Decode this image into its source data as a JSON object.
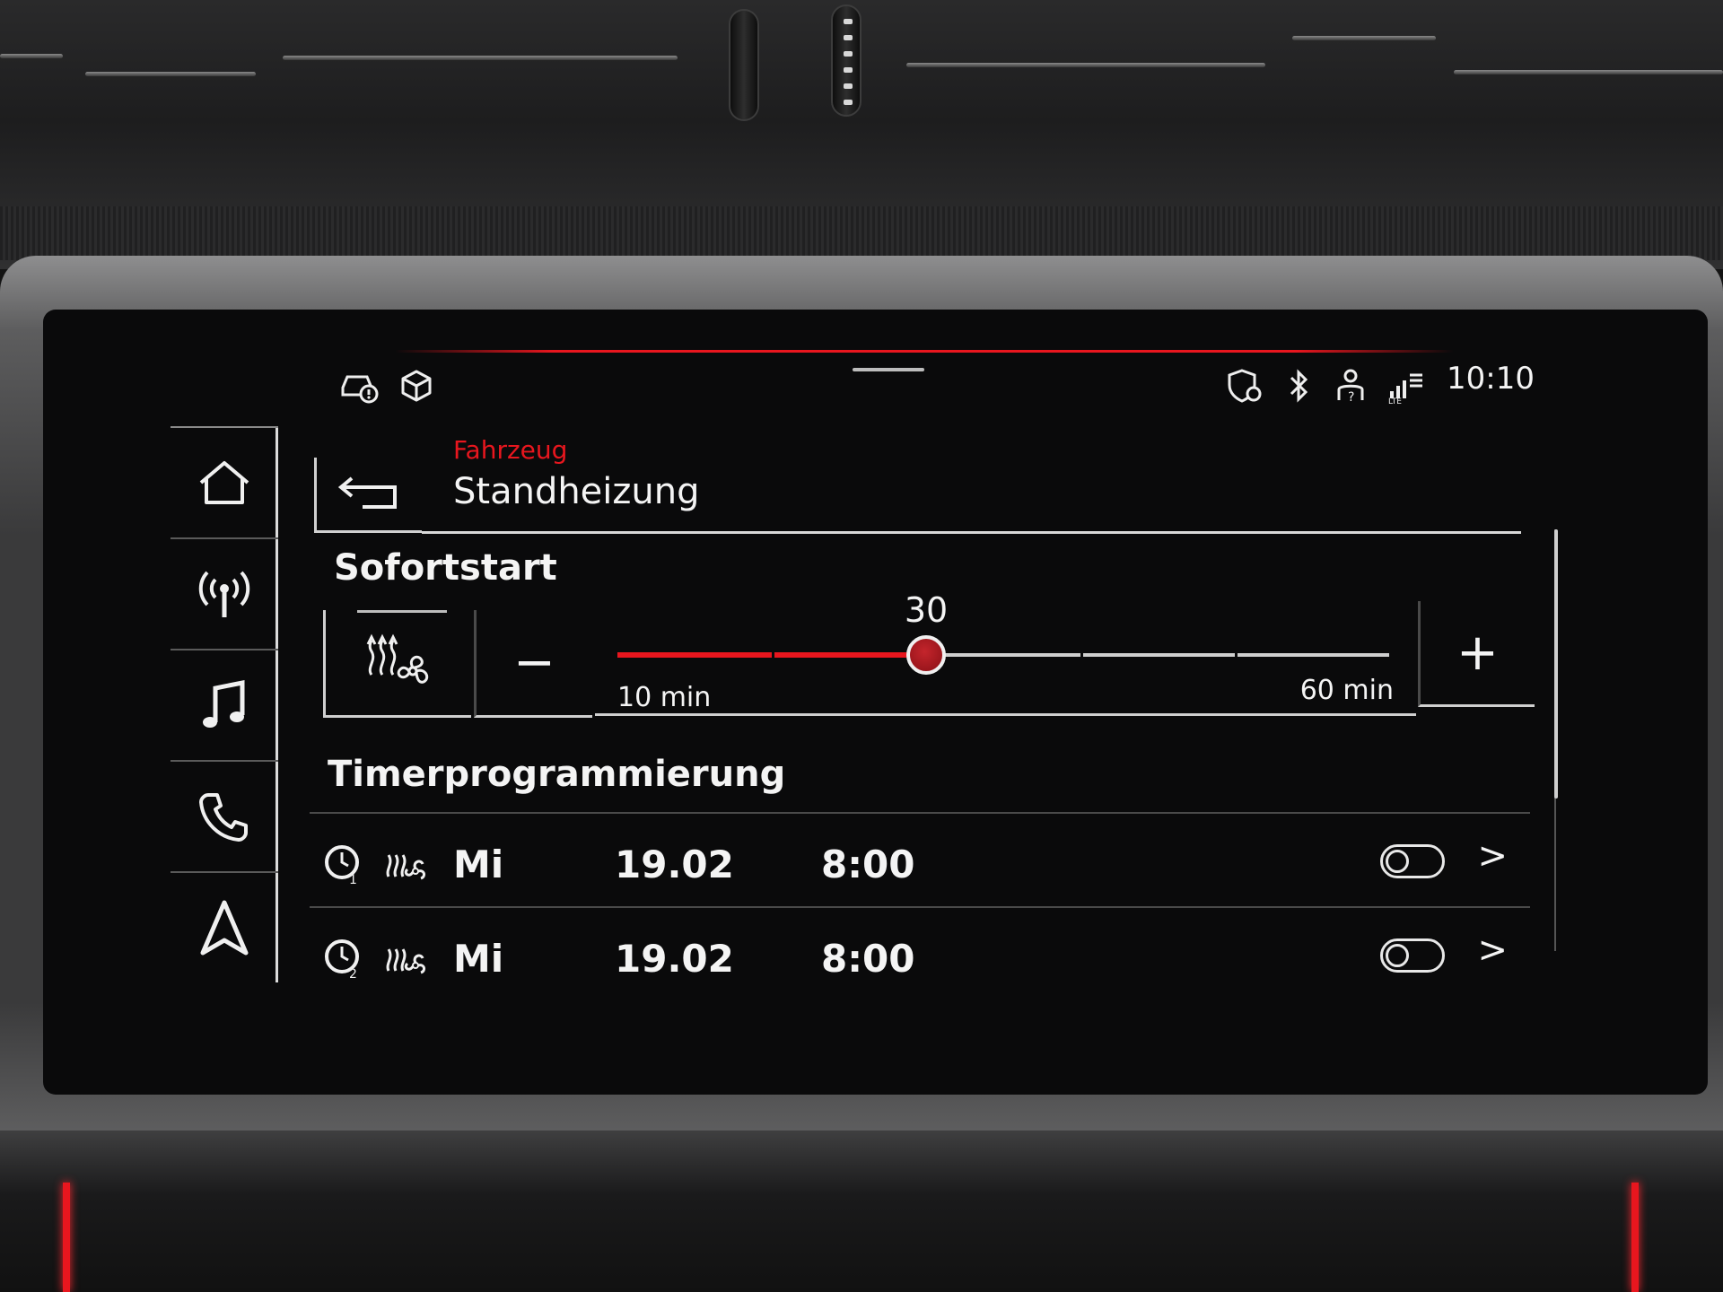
{
  "status_bar": {
    "time": "10:10",
    "icons_left": [
      "car-warning-icon",
      "cube-icon"
    ],
    "icons_right": [
      "shield-location-icon",
      "bluetooth-icon",
      "user-question-icon",
      "lte-signal-icon"
    ]
  },
  "nav": {
    "items": [
      {
        "icon": "home-icon"
      },
      {
        "icon": "radio-icon"
      },
      {
        "icon": "music-icon"
      },
      {
        "icon": "phone-icon"
      },
      {
        "icon": "navigation-icon"
      }
    ]
  },
  "header": {
    "breadcrumb": "Fahrzeug",
    "title": "Standheizung"
  },
  "sofortstart": {
    "label": "Sofortstart",
    "slider": {
      "value": 30,
      "value_label": "30",
      "min": 10,
      "max": 60,
      "min_label": "10 min",
      "max_label": "60 min"
    },
    "minus_label": "−",
    "plus_label": "+"
  },
  "timer": {
    "label": "Timerprogrammierung",
    "rows": [
      {
        "slot": "1",
        "day": "Mi",
        "date": "19.02",
        "time": "8:00",
        "enabled": false
      },
      {
        "slot": "2",
        "day": "Mi",
        "date": "19.02",
        "time": "8:00",
        "enabled": false
      }
    ]
  },
  "colors": {
    "accent_red": "#e8161e",
    "text": "#f4f4f4",
    "screen_bg": "#0a0a0b"
  }
}
